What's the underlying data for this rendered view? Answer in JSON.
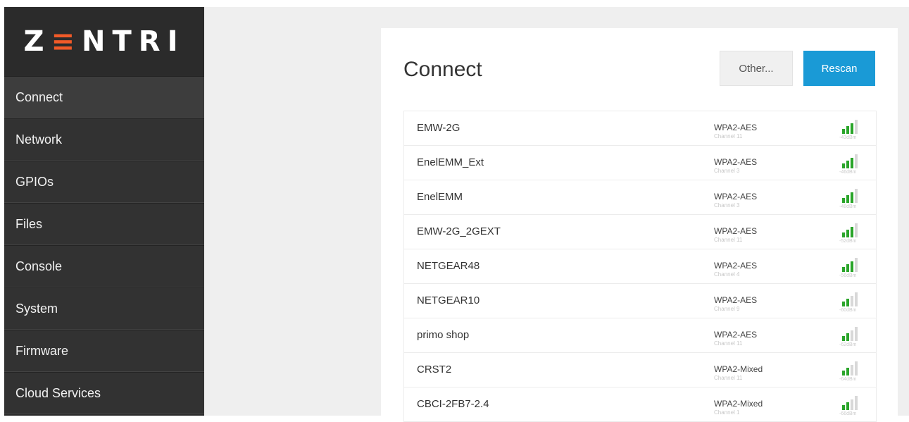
{
  "brand": {
    "logo_left": "Z",
    "logo_accent": "≡",
    "logo_right": "NTRI",
    "accent_color": "#f05a28"
  },
  "sidebar": {
    "items": [
      {
        "label": "Connect",
        "active": true
      },
      {
        "label": "Network"
      },
      {
        "label": "GPIOs"
      },
      {
        "label": "Files"
      },
      {
        "label": "Console"
      },
      {
        "label": "System"
      },
      {
        "label": "Firmware"
      },
      {
        "label": "Cloud Services"
      }
    ]
  },
  "main": {
    "title": "Connect",
    "other_label": "Other...",
    "rescan_label": "Rescan",
    "rescan_color": "#1a9ad6",
    "networks": [
      {
        "ssid": "EMW-2G",
        "security": "WPA2-AES",
        "channel": "Channel 11",
        "rssi": "-43dBm",
        "bars": 3
      },
      {
        "ssid": "EnelEMM_Ext",
        "security": "WPA2-AES",
        "channel": "Channel 3",
        "rssi": "-46dBm",
        "bars": 3
      },
      {
        "ssid": "EnelEMM",
        "security": "WPA2-AES",
        "channel": "Channel 3",
        "rssi": "-48dBm",
        "bars": 3
      },
      {
        "ssid": "EMW-2G_2GEXT",
        "security": "WPA2-AES",
        "channel": "Channel 11",
        "rssi": "-52dBm",
        "bars": 3
      },
      {
        "ssid": "NETGEAR48",
        "security": "WPA2-AES",
        "channel": "Channel 4",
        "rssi": "-56dBm",
        "bars": 3
      },
      {
        "ssid": "NETGEAR10",
        "security": "WPA2-AES",
        "channel": "Channel 9",
        "rssi": "-60dBm",
        "bars": 2
      },
      {
        "ssid": "primo shop",
        "security": "WPA2-AES",
        "channel": "Channel 11",
        "rssi": "-62dBm",
        "bars": 2
      },
      {
        "ssid": "CRST2",
        "security": "WPA2-Mixed",
        "channel": "Channel 11",
        "rssi": "-64dBm",
        "bars": 2
      },
      {
        "ssid": "CBCI-2FB7-2.4",
        "security": "WPA2-Mixed",
        "channel": "Channel 1",
        "rssi": "-66dBm",
        "bars": 2
      }
    ],
    "signal_on_color": "#2aa52a",
    "signal_off_color": "#d8d8d8"
  }
}
